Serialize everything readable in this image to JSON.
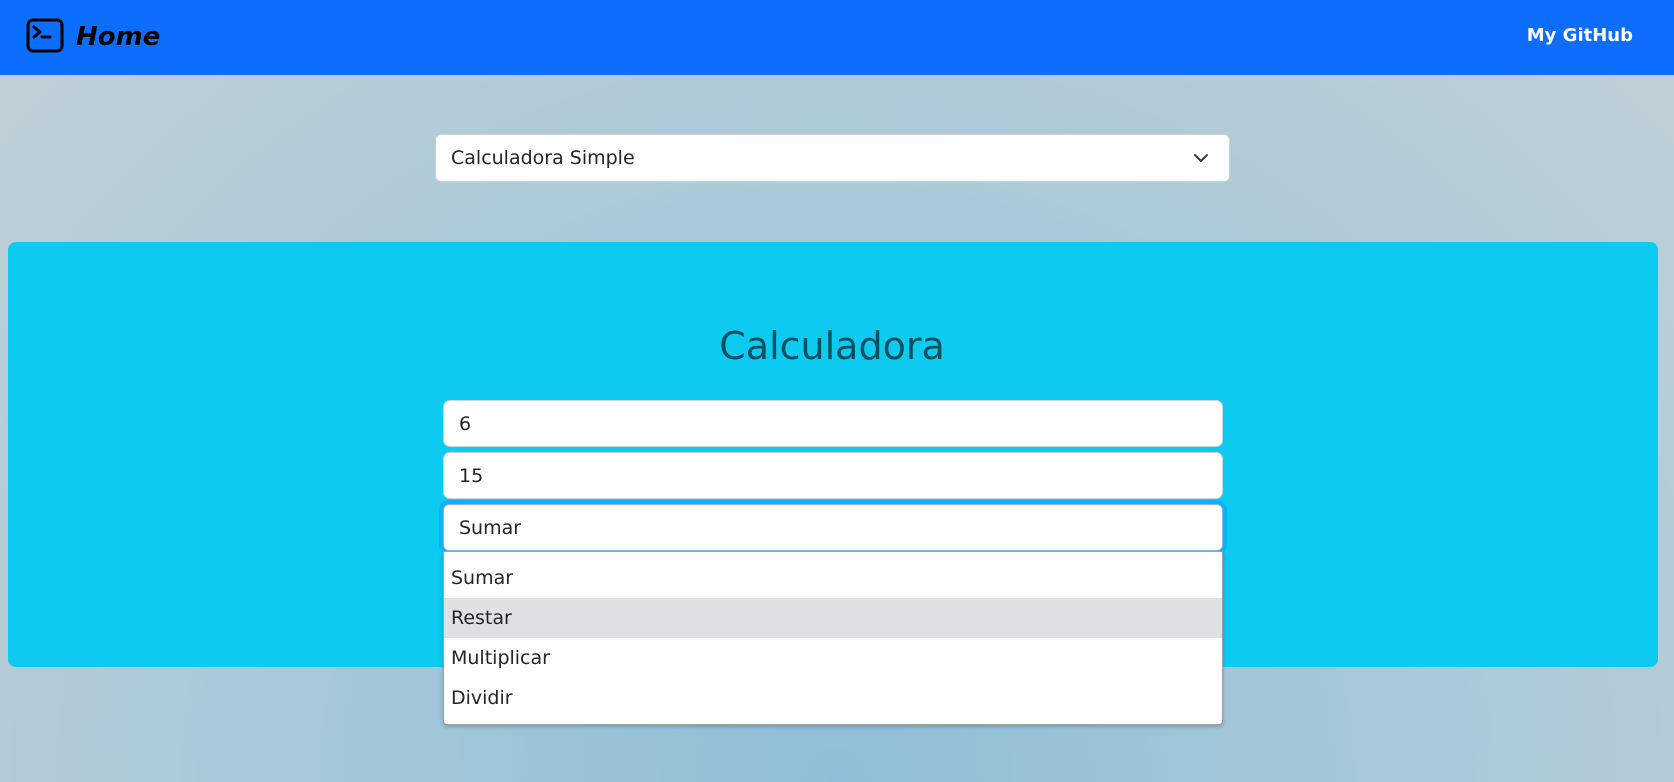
{
  "navbar": {
    "brand": "Home",
    "brand_icon": "terminal-icon",
    "github_label": "My GitHub",
    "background": "#0d6efd"
  },
  "mode_select": {
    "value": "Calculadora Simple",
    "icon": "chevron-down-icon"
  },
  "calculator": {
    "title": "Calculadora",
    "panel_color": "#0dcaf0",
    "input_a": "6",
    "input_b": "15",
    "operation": "Sumar",
    "options": [
      "Sumar",
      "Restar",
      "Multiplicar",
      "Dividir"
    ],
    "highlighted_option": "Restar"
  }
}
